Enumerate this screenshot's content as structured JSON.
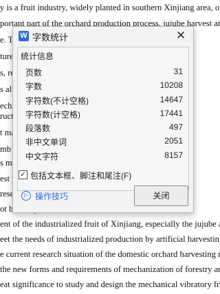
{
  "document": {
    "lines": [
      "y is a fruit industry, widely planted in southern Xinjiang area, orch",
      "portant part of the orchard production process. jujube harvest and l",
      "e. Th                                                      reds of",
      "ture,                                                       ",
      "s, res                                                nization",
      "s alv                                                   ad. At p",
      "echa                                                  ology in",
      "ructi                                                     to 10 tim",
      "t ma                                                  overy m",
      "mb                                                     echanica",
      "s mo                                                   models.",
      "est                                                    picking",
      "resea                                                  ncy in ou",
      "ot be                                                  . At pre",
      "ent of the industrialized fruit of Xinjiang, especially the jujube and",
      "eet the needs of industrialized production by artificial harvesting.",
      "e current research situation of the domestic orchard harvesting mach",
      "the new forms and requirements of mechanization of forestry and fr",
      "eat significance to study and design the mechanical vibratory fruit"
    ]
  },
  "dialog": {
    "app_icon_letter": "W",
    "title": "字数统计",
    "close_symbol": "✕",
    "section_title": "统计信息",
    "stats": [
      {
        "label": "页数",
        "value": "31"
      },
      {
        "label": "字数",
        "value": "10208"
      },
      {
        "label": "字符数(不计空格)",
        "value": "14647"
      },
      {
        "label": "字符数(计空格)",
        "value": "17441"
      },
      {
        "label": "段落数",
        "value": "497"
      },
      {
        "label": "非中文单词",
        "value": "2051"
      },
      {
        "label": "中文字符",
        "value": "8157"
      }
    ],
    "include_checkbox": {
      "checked_symbol": "✓",
      "label": "包括文本框、脚注和尾注(F)"
    },
    "tips_icon_symbol": "▷",
    "tips_label": "操作技巧",
    "close_button_label": "关闭"
  }
}
